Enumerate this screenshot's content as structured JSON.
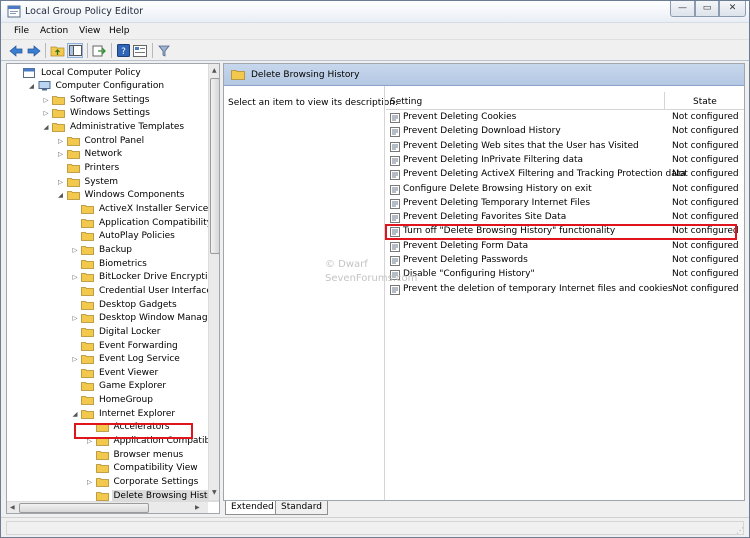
{
  "window": {
    "title": "Local Group Policy Editor",
    "caption_buttons": {
      "minimize": "—",
      "maximize": "▭",
      "close": "✕"
    }
  },
  "menubar": [
    {
      "label": "File"
    },
    {
      "label": "Action"
    },
    {
      "label": "View"
    },
    {
      "label": "Help"
    }
  ],
  "toolbar": [
    {
      "icon": "back-arrow-icon"
    },
    {
      "icon": "forward-arrow-icon"
    },
    {
      "icon": "up-folder-icon"
    },
    {
      "icon": "show-hide-tree-icon"
    },
    {
      "icon": "export-list-icon"
    },
    {
      "icon": "help-icon"
    },
    {
      "icon": "properties-icon"
    },
    {
      "icon": "filter-icon"
    }
  ],
  "tree": [
    {
      "label": "Local Computer Policy",
      "level": 0,
      "expander": "none"
    },
    {
      "label": "Computer Configuration",
      "level": 1,
      "expander": "expanded"
    },
    {
      "label": "Software Settings",
      "level": 2,
      "expander": "collapsed"
    },
    {
      "label": "Windows Settings",
      "level": 2,
      "expander": "collapsed"
    },
    {
      "label": "Administrative Templates",
      "level": 2,
      "expander": "expanded"
    },
    {
      "label": "Control Panel",
      "level": 3,
      "expander": "collapsed"
    },
    {
      "label": "Network",
      "level": 3,
      "expander": "collapsed"
    },
    {
      "label": "Printers",
      "level": 3,
      "expander": "none"
    },
    {
      "label": "System",
      "level": 3,
      "expander": "collapsed"
    },
    {
      "label": "Windows Components",
      "level": 3,
      "expander": "expanded"
    },
    {
      "label": "ActiveX Installer Service",
      "level": 4,
      "expander": "none"
    },
    {
      "label": "Application Compatibility",
      "level": 4,
      "expander": "none"
    },
    {
      "label": "AutoPlay Policies",
      "level": 4,
      "expander": "none"
    },
    {
      "label": "Backup",
      "level": 4,
      "expander": "collapsed"
    },
    {
      "label": "Biometrics",
      "level": 4,
      "expander": "none"
    },
    {
      "label": "BitLocker Drive Encryption",
      "level": 4,
      "expander": "collapsed"
    },
    {
      "label": "Credential User Interface",
      "level": 4,
      "expander": "none"
    },
    {
      "label": "Desktop Gadgets",
      "level": 4,
      "expander": "none"
    },
    {
      "label": "Desktop Window Manager",
      "level": 4,
      "expander": "collapsed"
    },
    {
      "label": "Digital Locker",
      "level": 4,
      "expander": "none"
    },
    {
      "label": "Event Forwarding",
      "level": 4,
      "expander": "none"
    },
    {
      "label": "Event Log Service",
      "level": 4,
      "expander": "collapsed"
    },
    {
      "label": "Event Viewer",
      "level": 4,
      "expander": "none"
    },
    {
      "label": "Game Explorer",
      "level": 4,
      "expander": "none"
    },
    {
      "label": "HomeGroup",
      "level": 4,
      "expander": "none"
    },
    {
      "label": "Internet Explorer",
      "level": 4,
      "expander": "expanded"
    },
    {
      "label": "Accelerators",
      "level": 5,
      "expander": "none"
    },
    {
      "label": "Application Compatibility",
      "level": 5,
      "expander": "collapsed"
    },
    {
      "label": "Browser menus",
      "level": 5,
      "expander": "none"
    },
    {
      "label": "Compatibility View",
      "level": 5,
      "expander": "none"
    },
    {
      "label": "Corporate Settings",
      "level": 5,
      "expander": "collapsed"
    },
    {
      "label": "Delete Browsing History",
      "level": 5,
      "expander": "none",
      "selected": true
    }
  ],
  "right_pane": {
    "header_title": "Delete Browsing History",
    "description": "Select an item to view its description.",
    "columns": {
      "setting": "Setting",
      "state": "State"
    },
    "rows": [
      {
        "name": "Prevent Deleting Cookies",
        "state": "Not configured"
      },
      {
        "name": "Prevent Deleting Download History",
        "state": "Not configured"
      },
      {
        "name": "Prevent Deleting Web sites that the User has Visited",
        "state": "Not configured"
      },
      {
        "name": "Prevent Deleting InPrivate Filtering data",
        "state": "Not configured"
      },
      {
        "name": "Prevent Deleting ActiveX Filtering and Tracking Protection data",
        "state": "Not configured"
      },
      {
        "name": "Configure Delete Browsing History on exit",
        "state": "Not configured"
      },
      {
        "name": "Prevent Deleting Temporary Internet Files",
        "state": "Not configured"
      },
      {
        "name": "Prevent Deleting Favorites Site Data",
        "state": "Not configured"
      },
      {
        "name": "Turn off \"Delete Browsing History\" functionality",
        "state": "Not configured",
        "highlighted": true
      },
      {
        "name": "Prevent Deleting Form Data",
        "state": "Not configured"
      },
      {
        "name": "Prevent Deleting Passwords",
        "state": "Not configured"
      },
      {
        "name": "Disable \"Configuring History\"",
        "state": "Not configured"
      },
      {
        "name": "Prevent the deletion of temporary Internet files and cookies",
        "state": "Not configured"
      }
    ],
    "watermark": "© Dwarf\nSevenForums.com"
  },
  "tabs": [
    {
      "label": "Extended",
      "active": true
    },
    {
      "label": "Standard",
      "active": false
    }
  ],
  "colors": {
    "highlight_red": "#e0141c",
    "folder_yellow": "#f2c94c",
    "header_blue": "#bcd0e8"
  }
}
